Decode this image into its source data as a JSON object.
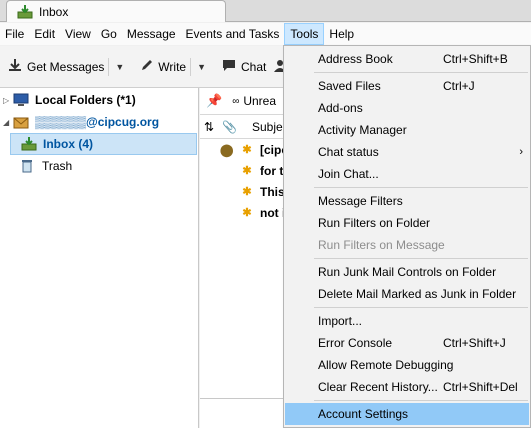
{
  "window": {
    "tab_title": "Inbox"
  },
  "menubar": {
    "items": [
      "File",
      "Edit",
      "View",
      "Go",
      "Message",
      "Events and Tasks",
      "Tools",
      "Help"
    ]
  },
  "toolbar": {
    "get_messages": "Get Messages",
    "write": "Write",
    "chat": "Chat"
  },
  "folders": {
    "local_folders": "Local Folders (*1)",
    "account": "▒▒▒▒▒▒@cipcug.org",
    "inbox": "Inbox (4)",
    "trash": "Trash"
  },
  "thread_pane": {
    "quick_filter_unread": "Unrea",
    "column_subject": "Subje",
    "messages": [
      "[cipcu",
      "for th",
      "This a",
      "not in"
    ]
  },
  "tools_menu": {
    "items": [
      {
        "label": "Address Book",
        "shortcut": "Ctrl+Shift+B"
      },
      {
        "label": "Saved Files",
        "shortcut": "Ctrl+J"
      },
      {
        "label": "Add-ons",
        "shortcut": ""
      },
      {
        "label": "Activity Manager",
        "shortcut": ""
      },
      {
        "label": "Chat status",
        "shortcut": ""
      },
      {
        "label": "Join Chat...",
        "shortcut": ""
      },
      {
        "label": "Message Filters",
        "shortcut": ""
      },
      {
        "label": "Run Filters on Folder",
        "shortcut": ""
      },
      {
        "label": "Run Filters on Message",
        "shortcut": ""
      },
      {
        "label": "Run Junk Mail Controls on Folder",
        "shortcut": ""
      },
      {
        "label": "Delete Mail Marked as Junk in Folder",
        "shortcut": ""
      },
      {
        "label": "Import...",
        "shortcut": ""
      },
      {
        "label": "Error Console",
        "shortcut": "Ctrl+Shift+J"
      },
      {
        "label": "Allow Remote Debugging",
        "shortcut": ""
      },
      {
        "label": "Clear Recent History...",
        "shortcut": "Ctrl+Shift+Del"
      },
      {
        "label": "Account Settings",
        "shortcut": ""
      }
    ]
  },
  "colors": {
    "highlight": "#91c9f7",
    "selection": "#cce4f7",
    "star": "#e8a000",
    "disabled_text": "#8d8d8d"
  }
}
